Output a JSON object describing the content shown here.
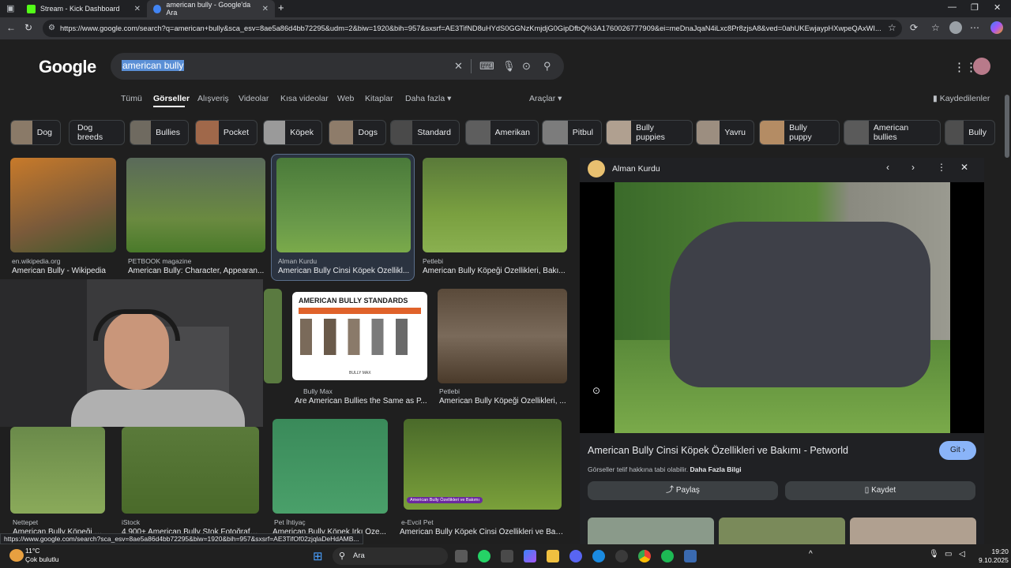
{
  "tabs": [
    {
      "title": "Stream - Kick Dashboard",
      "color": "#53fc18"
    },
    {
      "title": "american bully - Google'da Ara",
      "color": "#4285f4"
    }
  ],
  "url": "https://www.google.com/search?q=american+bully&sca_esv=8ae5a86d4bb72295&udm=2&biw=1920&bih=957&sxsrf=AE3TifND8uHYdS0GGNzKmjdjG0GipDfbQ%3A1760026777909&ei=meDnaJqaN4iLxc8Pr8zjsA8&ved=0ahUKEwjaypHXwpeQAxWI...",
  "logo": "Google",
  "search": {
    "query": "american bully"
  },
  "nav": {
    "tabs": [
      "Tümü",
      "Görseller",
      "Alışveriş",
      "Videolar",
      "Kısa videolar",
      "Web",
      "Kitaplar",
      "Daha fazla ▾"
    ],
    "tools": "Araçlar ▾",
    "saved": "Kaydedilenler"
  },
  "chips": [
    "Dog",
    "Dog breeds",
    "Bullies",
    "Pocket",
    "Köpek",
    "Dogs",
    "Standard",
    "Amerikan",
    "Pitbul",
    "Bully puppies",
    "Yavru",
    "Bully puppy",
    "American bullies",
    "Bully"
  ],
  "results": [
    {
      "source": "en.wikipedia.org",
      "title": "American Bully - Wikipedia"
    },
    {
      "source": "PETBOOK magazine",
      "title": "American Bully: Character, Appearan..."
    },
    {
      "source": "Alman Kurdu",
      "title": "American Bully Cinsi Köpek Özellikl..."
    },
    {
      "source": "Petlebi",
      "title": "American Bully Köpeği Özellikleri, Bakı..."
    },
    {
      "source": "Bully Max",
      "title": "Are American Bullies the Same as P..."
    },
    {
      "source": "Petlebi",
      "title": "American Bully Köpeği Özellikleri, ..."
    },
    {
      "source": "Nettepet",
      "title": "American Bully Köpeği Ö..."
    },
    {
      "source": "iStock",
      "title": "4.900+ American Bully Stok Fotoğrafla..."
    },
    {
      "source": "Pet İhtiyaç",
      "title": "American Bully Köpek Irkı Öze..."
    },
    {
      "source": "e-Evcil Pet",
      "title": "American Bully Köpek Cinsi Özellikleri ve Bakımı"
    }
  ],
  "standards_img": {
    "title": "AMERICAN BULLY STANDARDS",
    "footer": "BULLY MAX"
  },
  "overlay_tag": "American Bully Özellikleri ve Bakımı",
  "panel": {
    "source": "Alman Kurdu",
    "title": "American Bully Cinsi Köpek Özellikleri ve Bakımı - Petworld",
    "go": "Git ›",
    "copyright": "Görseller telif hakkına tabi olabilir.",
    "more_info": "Daha Fazla Bilgi",
    "share": "Paylaş",
    "save": "Kaydet"
  },
  "status_url": "https://www.google.com/search?sca_esv=8ae5a86d4bb72295&biw=1920&bih=957&sxsrf=AE3TifOf02zjqlaDeHdAMB...",
  "taskbar": {
    "temp": "11°C",
    "weather": "Çok bulutlu",
    "search": "Ara",
    "time": "19:20",
    "date": "9.10.2025"
  }
}
